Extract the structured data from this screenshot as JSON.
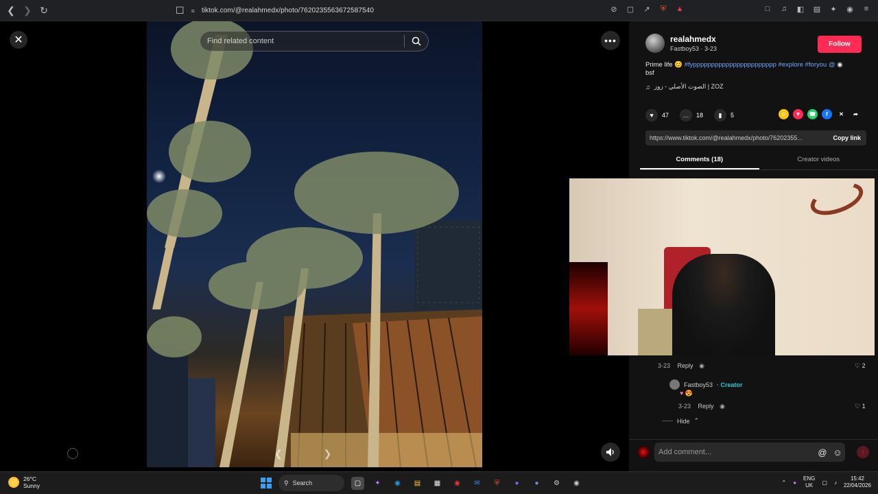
{
  "browser": {
    "url": "tiktok.com/@realahmedx/photo/7620235563672587540"
  },
  "viewer": {
    "search_placeholder": "Find related content"
  },
  "post": {
    "author": "realahmedx",
    "sub": "Fastboy53 · 3-23",
    "follow_label": "Follow",
    "caption_text": "Prime life 😊",
    "caption_tags": "#fyppppppppppppppppppppppp #explore #foryou @",
    "caption_tail": "bsf",
    "music": "الصوت الأصلي - زوز | ZOZ",
    "likes": "47",
    "comments": "18",
    "saves": "5",
    "link": "https://www.tiktok.com/@realahmedx/photo/76202355...",
    "copy_label": "Copy link"
  },
  "tabs": {
    "comments": "Comments (18)",
    "creator": "Creator videos"
  },
  "thread": {
    "c1_date": "3-23",
    "c1_reply": "Reply",
    "c1_likes": "2",
    "creator_name": "Fastboy53",
    "creator_badge": "· Creator",
    "creator_emojis": "♥ 😍",
    "c2_date": "3-23",
    "c2_reply": "Reply",
    "c2_likes": "1",
    "hide_label": "Hide"
  },
  "composer": {
    "placeholder": "Add comment..."
  },
  "taskbar": {
    "temp": "26°C",
    "condition": "Sunny",
    "search_label": "Search",
    "lang1": "ENG",
    "lang2": "UK",
    "time": "15:42",
    "date": "22/04/2026"
  },
  "colors": {
    "follow": "#fe2c55",
    "creator_badge": "#25c6d6",
    "tags": "#6ea8fe"
  }
}
